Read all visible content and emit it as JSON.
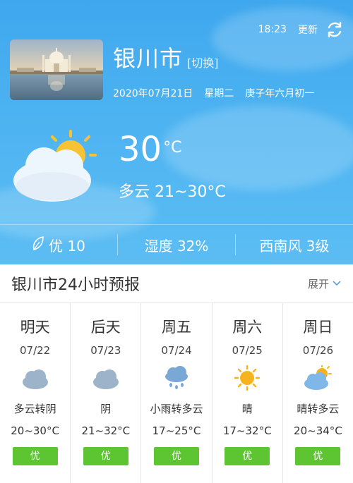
{
  "header": {
    "time": "18:23",
    "refresh_label": "更新",
    "city": "银川市",
    "switch_label": "[切换]",
    "date": "2020年07月21日",
    "weekday": "星期二",
    "lunar": "庚子年六月初一"
  },
  "current": {
    "temp": "30",
    "unit": "°C",
    "condition": "多云 21~30°C",
    "icon": "partly-cloudy-icon"
  },
  "stats": {
    "aqi": "优 10",
    "humidity": "湿度 32%",
    "wind": "西南风 3级"
  },
  "forecast": {
    "title": "银川市24小时预报",
    "expand_label": "展开",
    "days": [
      {
        "name": "明天",
        "date": "07/22",
        "condition": "多云转阴",
        "temp": "20~30°C",
        "aqi": "优",
        "icon": "cloudy-icon"
      },
      {
        "name": "后天",
        "date": "07/23",
        "condition": "阴",
        "temp": "21~32°C",
        "aqi": "优",
        "icon": "cloudy-icon"
      },
      {
        "name": "周五",
        "date": "07/24",
        "condition": "小雨转多云",
        "temp": "17~25°C",
        "aqi": "优",
        "icon": "light-rain-icon"
      },
      {
        "name": "周六",
        "date": "07/25",
        "condition": "晴",
        "temp": "17~32°C",
        "aqi": "优",
        "icon": "sunny-icon"
      },
      {
        "name": "周日",
        "date": "07/26",
        "condition": "晴转多云",
        "temp": "20~34°C",
        "aqi": "优",
        "icon": "partly-cloudy-icon"
      }
    ]
  },
  "colors": {
    "sky": "#4db3f1",
    "aqi_green": "#5cc531",
    "sun": "#f5b41d",
    "cloud_gray": "#9cb3c9"
  }
}
